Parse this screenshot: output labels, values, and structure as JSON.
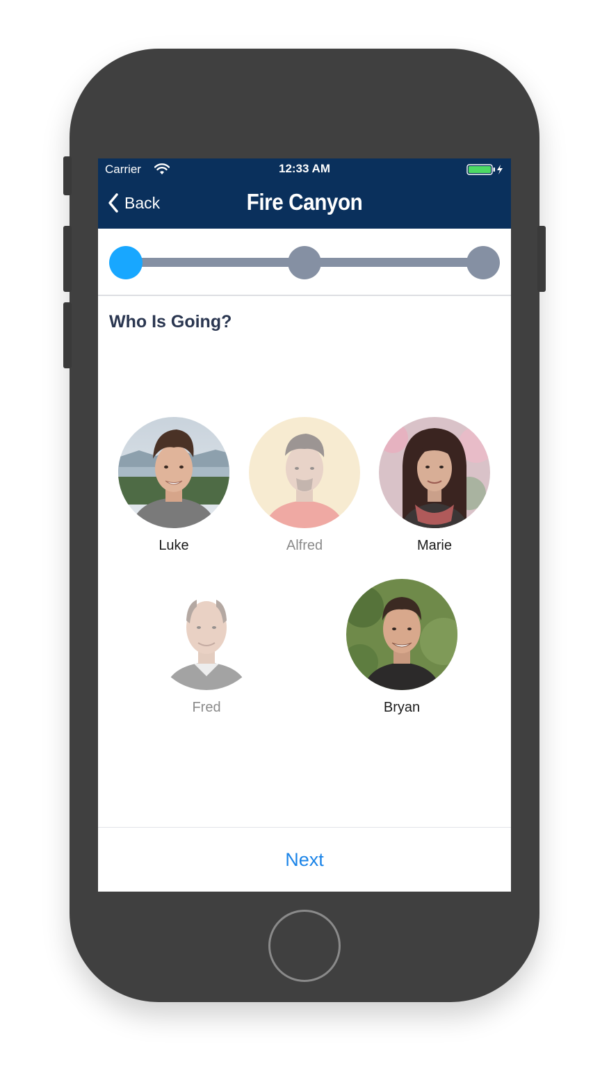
{
  "status_bar": {
    "carrier": "Carrier",
    "time": "12:33 AM",
    "battery_color": "#4cd964"
  },
  "nav_bar": {
    "back_label": "Back",
    "title": "Fire Canyon",
    "background_color": "#0a305c"
  },
  "stepper": {
    "total_steps": 3,
    "current_step": 1,
    "active_color": "#18a7ff",
    "inactive_color": "#8590a3"
  },
  "content": {
    "heading": "Who Is Going?"
  },
  "people": [
    {
      "name": "Luke",
      "selected": true
    },
    {
      "name": "Alfred",
      "selected": false
    },
    {
      "name": "Marie",
      "selected": true
    },
    {
      "name": "Fred",
      "selected": false
    },
    {
      "name": "Bryan",
      "selected": true
    }
  ],
  "footer": {
    "next_label": "Next",
    "accent_color": "#1b84e8"
  }
}
